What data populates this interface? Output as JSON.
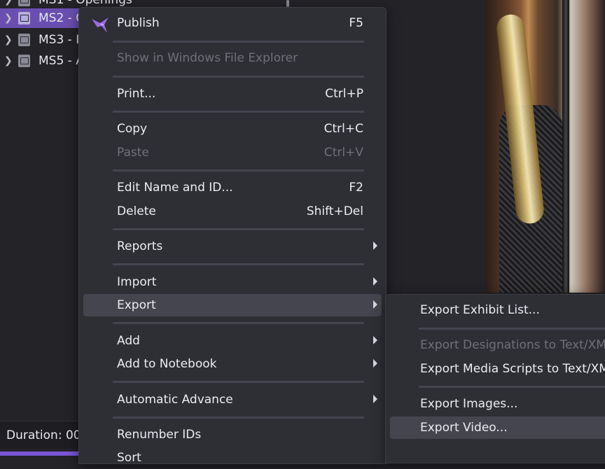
{
  "tree": {
    "items": [
      {
        "label": "MS1 - Openings",
        "selected": false
      },
      {
        "label": "MS2 - C",
        "selected": true
      },
      {
        "label": "MS3 - I",
        "selected": false
      },
      {
        "label": "MS5 - A",
        "selected": false
      }
    ]
  },
  "status": {
    "duration_label": "Duration: 00:"
  },
  "context_menu": {
    "items": [
      {
        "label": "Publish",
        "shortcut": "F5"
      },
      {
        "label": "Show in Windows File Explorer",
        "disabled": true
      },
      {
        "label": "Print...",
        "shortcut": "Ctrl+P"
      },
      {
        "label": "Copy",
        "shortcut": "Ctrl+C"
      },
      {
        "label": "Paste",
        "shortcut": "Ctrl+V",
        "disabled": true
      },
      {
        "label": "Edit Name and ID...",
        "shortcut": "F2"
      },
      {
        "label": "Delete",
        "shortcut": "Shift+Del"
      },
      {
        "label": "Reports",
        "submenu": true
      },
      {
        "label": "Import",
        "submenu": true
      },
      {
        "label": "Export",
        "submenu": true,
        "highlighted": true
      },
      {
        "label": "Add",
        "submenu": true
      },
      {
        "label": "Add to Notebook",
        "submenu": true
      },
      {
        "label": "Automatic Advance",
        "submenu": true
      },
      {
        "label": "Renumber IDs"
      },
      {
        "label": "Sort",
        "submenu": true
      }
    ]
  },
  "export_submenu": {
    "items": [
      {
        "label": "Export Exhibit List..."
      },
      {
        "label": "Export Designations to Text/XML...",
        "disabled": true
      },
      {
        "label": "Export Media Scripts to Text/XML..."
      },
      {
        "label": "Export Images..."
      },
      {
        "label": "Export Video...",
        "highlighted": true
      }
    ]
  },
  "icons": {
    "tree_chevron": "chevron-right-icon",
    "tree_item": "sequence-icon",
    "publish": "hummingbird-icon",
    "submenu_arrow": "caret-right-icon"
  },
  "colors": {
    "accent": "#6a4fb0",
    "menu_bg": "#2e2e35",
    "menu_hover": "#45454f",
    "disabled_text": "#707078"
  }
}
